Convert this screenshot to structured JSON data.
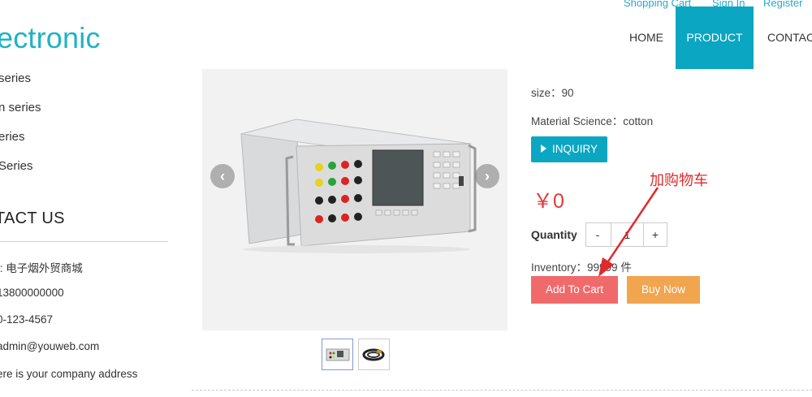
{
  "header": {
    "links": [
      "Shopping Cart",
      "Sign In",
      "Register"
    ],
    "logo_text": "ectronic",
    "nav": [
      {
        "label": "HOME",
        "active": false
      },
      {
        "label": "PRODUCT",
        "active": true
      },
      {
        "label": "CONTACT",
        "active": false
      }
    ]
  },
  "sidebar": {
    "categories": [
      "series",
      "n series",
      "eries",
      "Series"
    ],
    "contact_title": "TACT US",
    "contact_lines": [
      "t: 电子烟外贸商城",
      " 13800000000",
      "0-123-4567",
      " admin@youweb.com",
      "ere is your company address"
    ]
  },
  "gallery": {
    "prev_label": "‹",
    "next_label": "›",
    "thumbnail_count": 2,
    "active_thumbnail": 1
  },
  "product": {
    "size_label": "size：",
    "size_value": "90",
    "material_label": "Material Science：",
    "material_value": "cotton",
    "inquiry_label": "INQUIRY",
    "price": "￥0",
    "quantity_label": "Quantity",
    "qty_minus": "-",
    "qty_plus": "+",
    "qty_value": "1",
    "inventory_text": "Inventory：99999 件",
    "add_to_cart_label": "Add To Cart",
    "buy_now_label": "Buy Now"
  },
  "annotation": {
    "text": "加购物车",
    "color": "#e02a2a"
  },
  "colors": {
    "brand": "#0aa6c2",
    "cart": "#f06a6c",
    "buy": "#f1a54f",
    "price": "#e4393c"
  }
}
